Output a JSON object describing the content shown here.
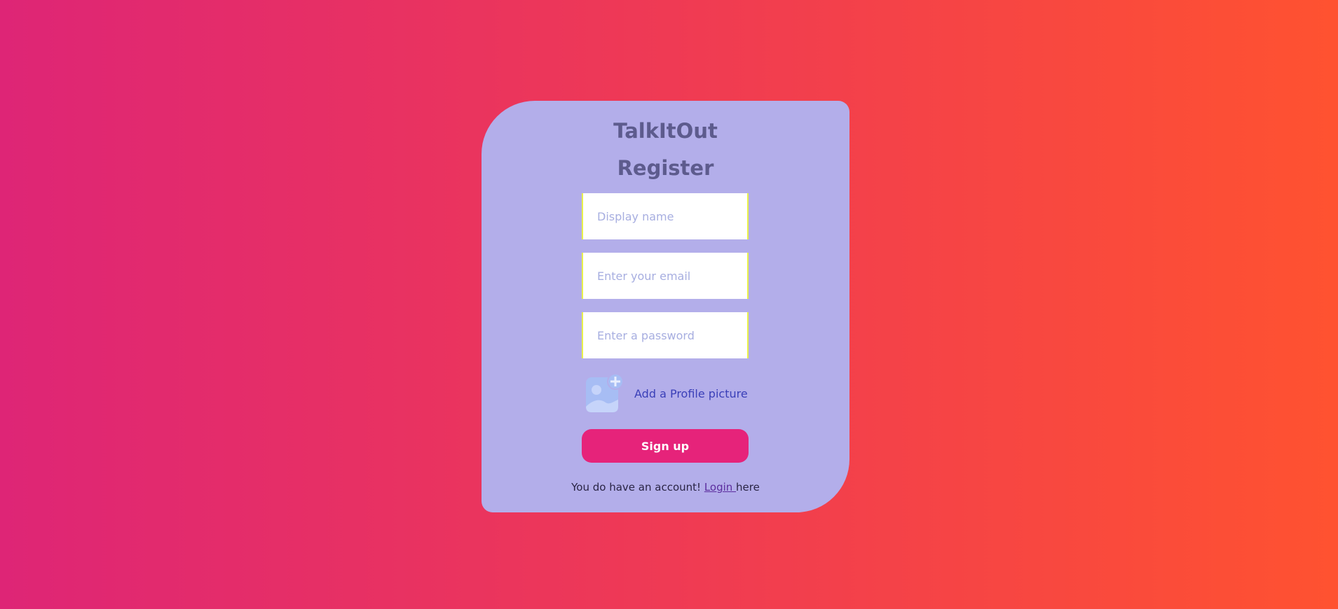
{
  "app": {
    "title": "TalkItOut"
  },
  "form": {
    "heading": "Register",
    "fields": {
      "display_name": {
        "placeholder": "Display name",
        "value": ""
      },
      "email": {
        "placeholder": "Enter your email",
        "value": ""
      },
      "password": {
        "placeholder": "Enter a password",
        "value": ""
      }
    },
    "avatar": {
      "icon": "add-image-icon",
      "label": "Add a Profile picture"
    },
    "submit_label": "Sign up"
  },
  "footer": {
    "prefix": "You do have an account! ",
    "link_label": "Login ",
    "suffix": "here"
  },
  "colors": {
    "background_start": "#de2576",
    "background_end": "#ff5230",
    "card": "#b3aeea",
    "heading": "#5d5b8d",
    "button": "#e6237a",
    "link": "#5c2d9e"
  }
}
